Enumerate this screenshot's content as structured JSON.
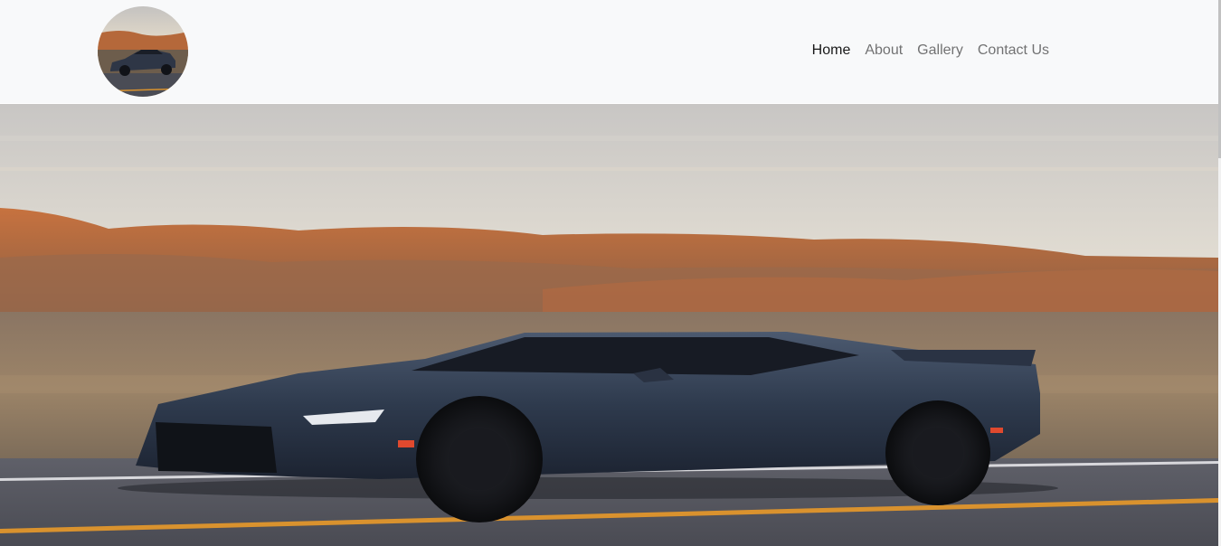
{
  "nav": {
    "items": [
      {
        "label": "Home",
        "active": true
      },
      {
        "label": "About",
        "active": false
      },
      {
        "label": "Gallery",
        "active": false
      },
      {
        "label": "Contact Us",
        "active": false
      }
    ]
  },
  "logo": {
    "alt": "car logo"
  },
  "hero": {
    "alt": "dark grey sports car driving on desert road at sunset"
  },
  "colors": {
    "navbar_bg": "#f8f9fa",
    "nav_link": "rgba(0,0,0,0.55)",
    "nav_link_active": "rgba(0,0,0,0.9)"
  }
}
